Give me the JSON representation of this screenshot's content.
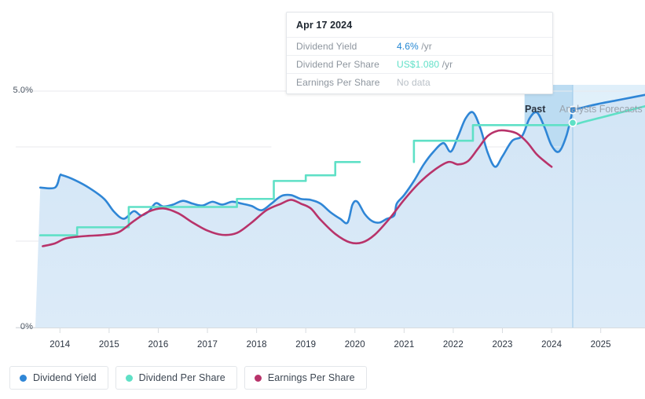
{
  "tooltip": {
    "date": "Apr 17 2024",
    "rows": [
      {
        "key": "Dividend Yield",
        "value": "4.6%",
        "unit": " /yr",
        "style": "blue"
      },
      {
        "key": "Dividend Per Share",
        "value": "US$1.080",
        "unit": " /yr",
        "style": "teal"
      },
      {
        "key": "Earnings Per Share",
        "value": "No data",
        "unit": "",
        "style": "none"
      }
    ]
  },
  "axes": {
    "y_top_label": "5.0%",
    "y_bottom_label": "0%",
    "x_labels": [
      "2014",
      "2015",
      "2016",
      "2017",
      "2018",
      "2019",
      "2020",
      "2021",
      "2022",
      "2023",
      "2024",
      "2025"
    ]
  },
  "periods": {
    "past_label": "Past",
    "forecast_label": "Analysts Forecasts"
  },
  "legend": [
    {
      "label": "Dividend Yield",
      "color": "#2f86d6"
    },
    {
      "label": "Dividend Per Share",
      "color": "#5fe0c6"
    },
    {
      "label": "Earnings Per Share",
      "color": "#b8336a"
    }
  ],
  "colors": {
    "dividend_yield": "#2f86d6",
    "dividend_per_share": "#5fe0c6",
    "earnings_per_share": "#b8336a",
    "area_fill": "#d3e6f7",
    "past_band": "#bcdcf2",
    "forecast_fill": "#e8f3fb",
    "gridline": "#e8eaed"
  },
  "chart_data": {
    "type": "line",
    "title": "",
    "xlabel": "",
    "ylabel": "",
    "ylim": [
      0,
      5.4
    ],
    "xlim": [
      2013.5,
      2025.9
    ],
    "grid": true,
    "legend_position": "bottom-left",
    "y_ticks": [
      0,
      5.0
    ],
    "y_tick_labels": [
      "0%",
      "5.0%"
    ],
    "x_ticks": [
      2014,
      2015,
      2016,
      2017,
      2018,
      2019,
      2020,
      2021,
      2022,
      2023,
      2024,
      2025
    ],
    "annotations": [
      {
        "text": "Past",
        "x": 2023.9,
        "type": "period-label"
      },
      {
        "text": "Analysts Forecasts",
        "x": 2024.6,
        "type": "period-label"
      }
    ],
    "regions": [
      {
        "name": "past-highlight",
        "x0": 2023.45,
        "x1": 2024.43,
        "fill": "#bcdcf2"
      },
      {
        "name": "forecast",
        "x0": 2024.43,
        "x1": 2025.9,
        "fill": "#e8f3fb"
      }
    ],
    "cursor": {
      "x": 2024.43,
      "date": "Apr 17 2024"
    },
    "markers": [
      {
        "series": "Dividend Yield",
        "x": 2024.43,
        "y": 4.6
      },
      {
        "series": "Dividend Per Share",
        "x": 2024.43,
        "y": 4.33
      }
    ],
    "series": [
      {
        "name": "Dividend Yield",
        "color": "#2f86d6",
        "filled": true,
        "x": [
          2013.6,
          2013.9,
          2014.0,
          2014.05,
          2014.3,
          2014.6,
          2014.9,
          2015.1,
          2015.3,
          2015.5,
          2015.65,
          2015.8,
          2015.95,
          2016.1,
          2016.3,
          2016.5,
          2016.7,
          2016.9,
          2017.1,
          2017.3,
          2017.5,
          2017.7,
          2017.9,
          2018.1,
          2018.3,
          2018.5,
          2018.7,
          2018.9,
          2019.1,
          2019.3,
          2019.5,
          2019.7,
          2019.85,
          2019.95,
          2020.05,
          2020.2,
          2020.35,
          2020.5,
          2020.65,
          2020.8,
          2020.85,
          2021.0,
          2021.2,
          2021.4,
          2021.6,
          2021.8,
          2021.95,
          2022.1,
          2022.25,
          2022.4,
          2022.55,
          2022.7,
          2022.85,
          2023.0,
          2023.2,
          2023.4,
          2023.55,
          2023.7,
          2023.85,
          2024.0,
          2024.15,
          2024.3,
          2024.43
        ],
        "y": [
          2.96,
          2.96,
          3.21,
          3.22,
          3.12,
          2.95,
          2.72,
          2.45,
          2.3,
          2.46,
          2.37,
          2.45,
          2.63,
          2.56,
          2.6,
          2.68,
          2.62,
          2.58,
          2.66,
          2.6,
          2.66,
          2.62,
          2.57,
          2.48,
          2.62,
          2.78,
          2.8,
          2.72,
          2.7,
          2.62,
          2.44,
          2.3,
          2.22,
          2.6,
          2.66,
          2.4,
          2.25,
          2.22,
          2.3,
          2.37,
          2.62,
          2.8,
          3.1,
          3.45,
          3.72,
          3.9,
          3.72,
          4.05,
          4.42,
          4.55,
          4.22,
          3.7,
          3.4,
          3.62,
          3.95,
          4.05,
          4.42,
          4.55,
          4.25,
          3.85,
          3.72,
          4.05,
          4.6
        ],
        "forecast_x": [
          2024.43,
          2024.7,
          2025.0,
          2025.3,
          2025.6,
          2025.9
        ],
        "forecast_y": [
          4.6,
          4.67,
          4.74,
          4.8,
          4.86,
          4.92
        ]
      },
      {
        "name": "Dividend Per Share",
        "color": "#5fe0c6",
        "step": true,
        "x": [
          2013.6,
          2014.35,
          2014.35,
          2015.4,
          2015.4,
          2017.6,
          2017.6,
          2018.35,
          2018.35,
          2019.0,
          2019.0,
          2019.6,
          2019.6,
          2020.1,
          2021.2,
          2021.2,
          2022.4,
          2022.4,
          2024.43
        ],
        "y": [
          1.95,
          1.95,
          2.12,
          2.12,
          2.55,
          2.55,
          2.72,
          2.72,
          3.1,
          3.1,
          3.22,
          3.22,
          3.5,
          3.5,
          3.5,
          3.95,
          3.95,
          4.28,
          4.28
        ],
        "gap": [
          2020.1,
          2021.2
        ],
        "forecast_x": [
          2024.43,
          2024.7,
          2025.0,
          2025.3,
          2025.6,
          2025.9
        ],
        "forecast_y": [
          4.28,
          4.36,
          4.44,
          4.52,
          4.6,
          4.68
        ]
      },
      {
        "name": "Earnings Per Share",
        "color": "#b8336a",
        "x": [
          2013.65,
          2013.9,
          2014.1,
          2014.35,
          2014.6,
          2014.9,
          2015.2,
          2015.5,
          2015.8,
          2016.1,
          2016.4,
          2016.7,
          2017.0,
          2017.3,
          2017.6,
          2017.9,
          2018.2,
          2018.5,
          2018.7,
          2018.9,
          2019.1,
          2019.3,
          2019.6,
          2019.9,
          2020.15,
          2020.4,
          2020.7,
          2021.0,
          2021.3,
          2021.6,
          2021.9,
          2022.1,
          2022.3,
          2022.5,
          2022.7,
          2022.9,
          2023.1,
          2023.3,
          2023.5,
          2023.7,
          2023.9,
          2024.0
        ],
        "y": [
          1.72,
          1.78,
          1.88,
          1.92,
          1.94,
          1.96,
          2.02,
          2.25,
          2.45,
          2.52,
          2.42,
          2.22,
          2.05,
          1.96,
          2.0,
          2.22,
          2.48,
          2.62,
          2.7,
          2.62,
          2.52,
          2.28,
          1.98,
          1.8,
          1.8,
          1.96,
          2.3,
          2.7,
          3.05,
          3.32,
          3.5,
          3.45,
          3.52,
          3.78,
          4.05,
          4.16,
          4.16,
          4.1,
          3.92,
          3.66,
          3.48,
          3.4
        ]
      }
    ]
  }
}
